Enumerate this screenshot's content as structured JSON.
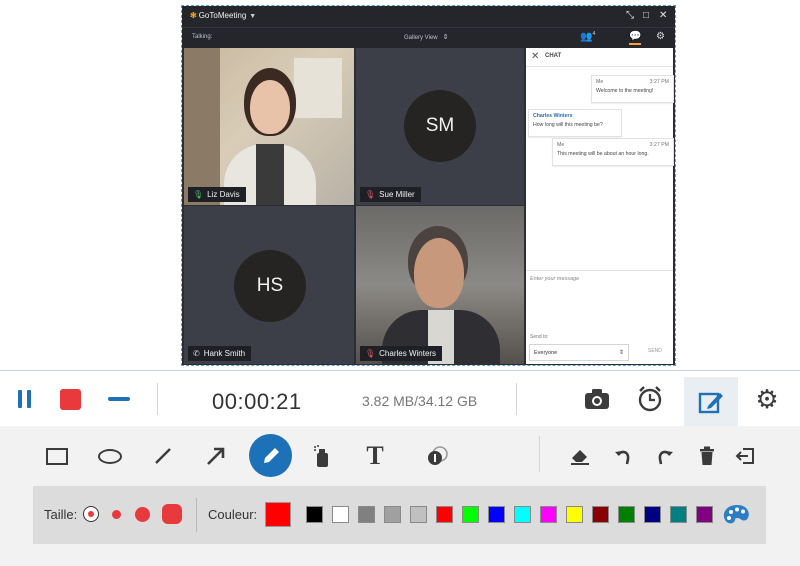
{
  "meeting": {
    "app_name": "GoToMeeting",
    "talking_label": "Talking:",
    "view_label": "Gallery View",
    "attendee_count": "4",
    "participants": [
      {
        "name": "Liz Davis"
      },
      {
        "name": "Sue Miller",
        "initials": "SM"
      },
      {
        "name": "Hank Smith",
        "initials": "HS"
      },
      {
        "name": "Charles Winters"
      }
    ],
    "chat": {
      "title": "CHAT",
      "messages": [
        {
          "sender": "Me",
          "time": "3:27 PM",
          "text": "Welcome to the meeting!"
        },
        {
          "sender": "Charles Winters",
          "time": "3:27 PM",
          "text": "How long will this meeting be?"
        },
        {
          "sender": "Me",
          "time": "3:27 PM",
          "text": "This meeting will be about an hour long."
        }
      ],
      "input_placeholder": "Enter your message",
      "send_to_label": "Send to:",
      "send_to_value": "Everyone",
      "send_label": "SEND"
    }
  },
  "recorder": {
    "timer": "00:00:21",
    "size_text": "3.82 MB/34.12 GB",
    "size_label": "Taille:",
    "color_label": "Couleur:",
    "current_color": "#ff0000",
    "palette": [
      "#000000",
      "#ffffff",
      "#808080",
      "#a0a0a0",
      "#c0c0c0",
      "#ff0000",
      "#00ff00",
      "#0000ff",
      "#00ffff",
      "#ff00ff",
      "#ffff00",
      "#8b0000",
      "#008000",
      "#000080",
      "#008080",
      "#800080"
    ],
    "accent": "#1d71b8",
    "record_color": "#e8393d"
  }
}
